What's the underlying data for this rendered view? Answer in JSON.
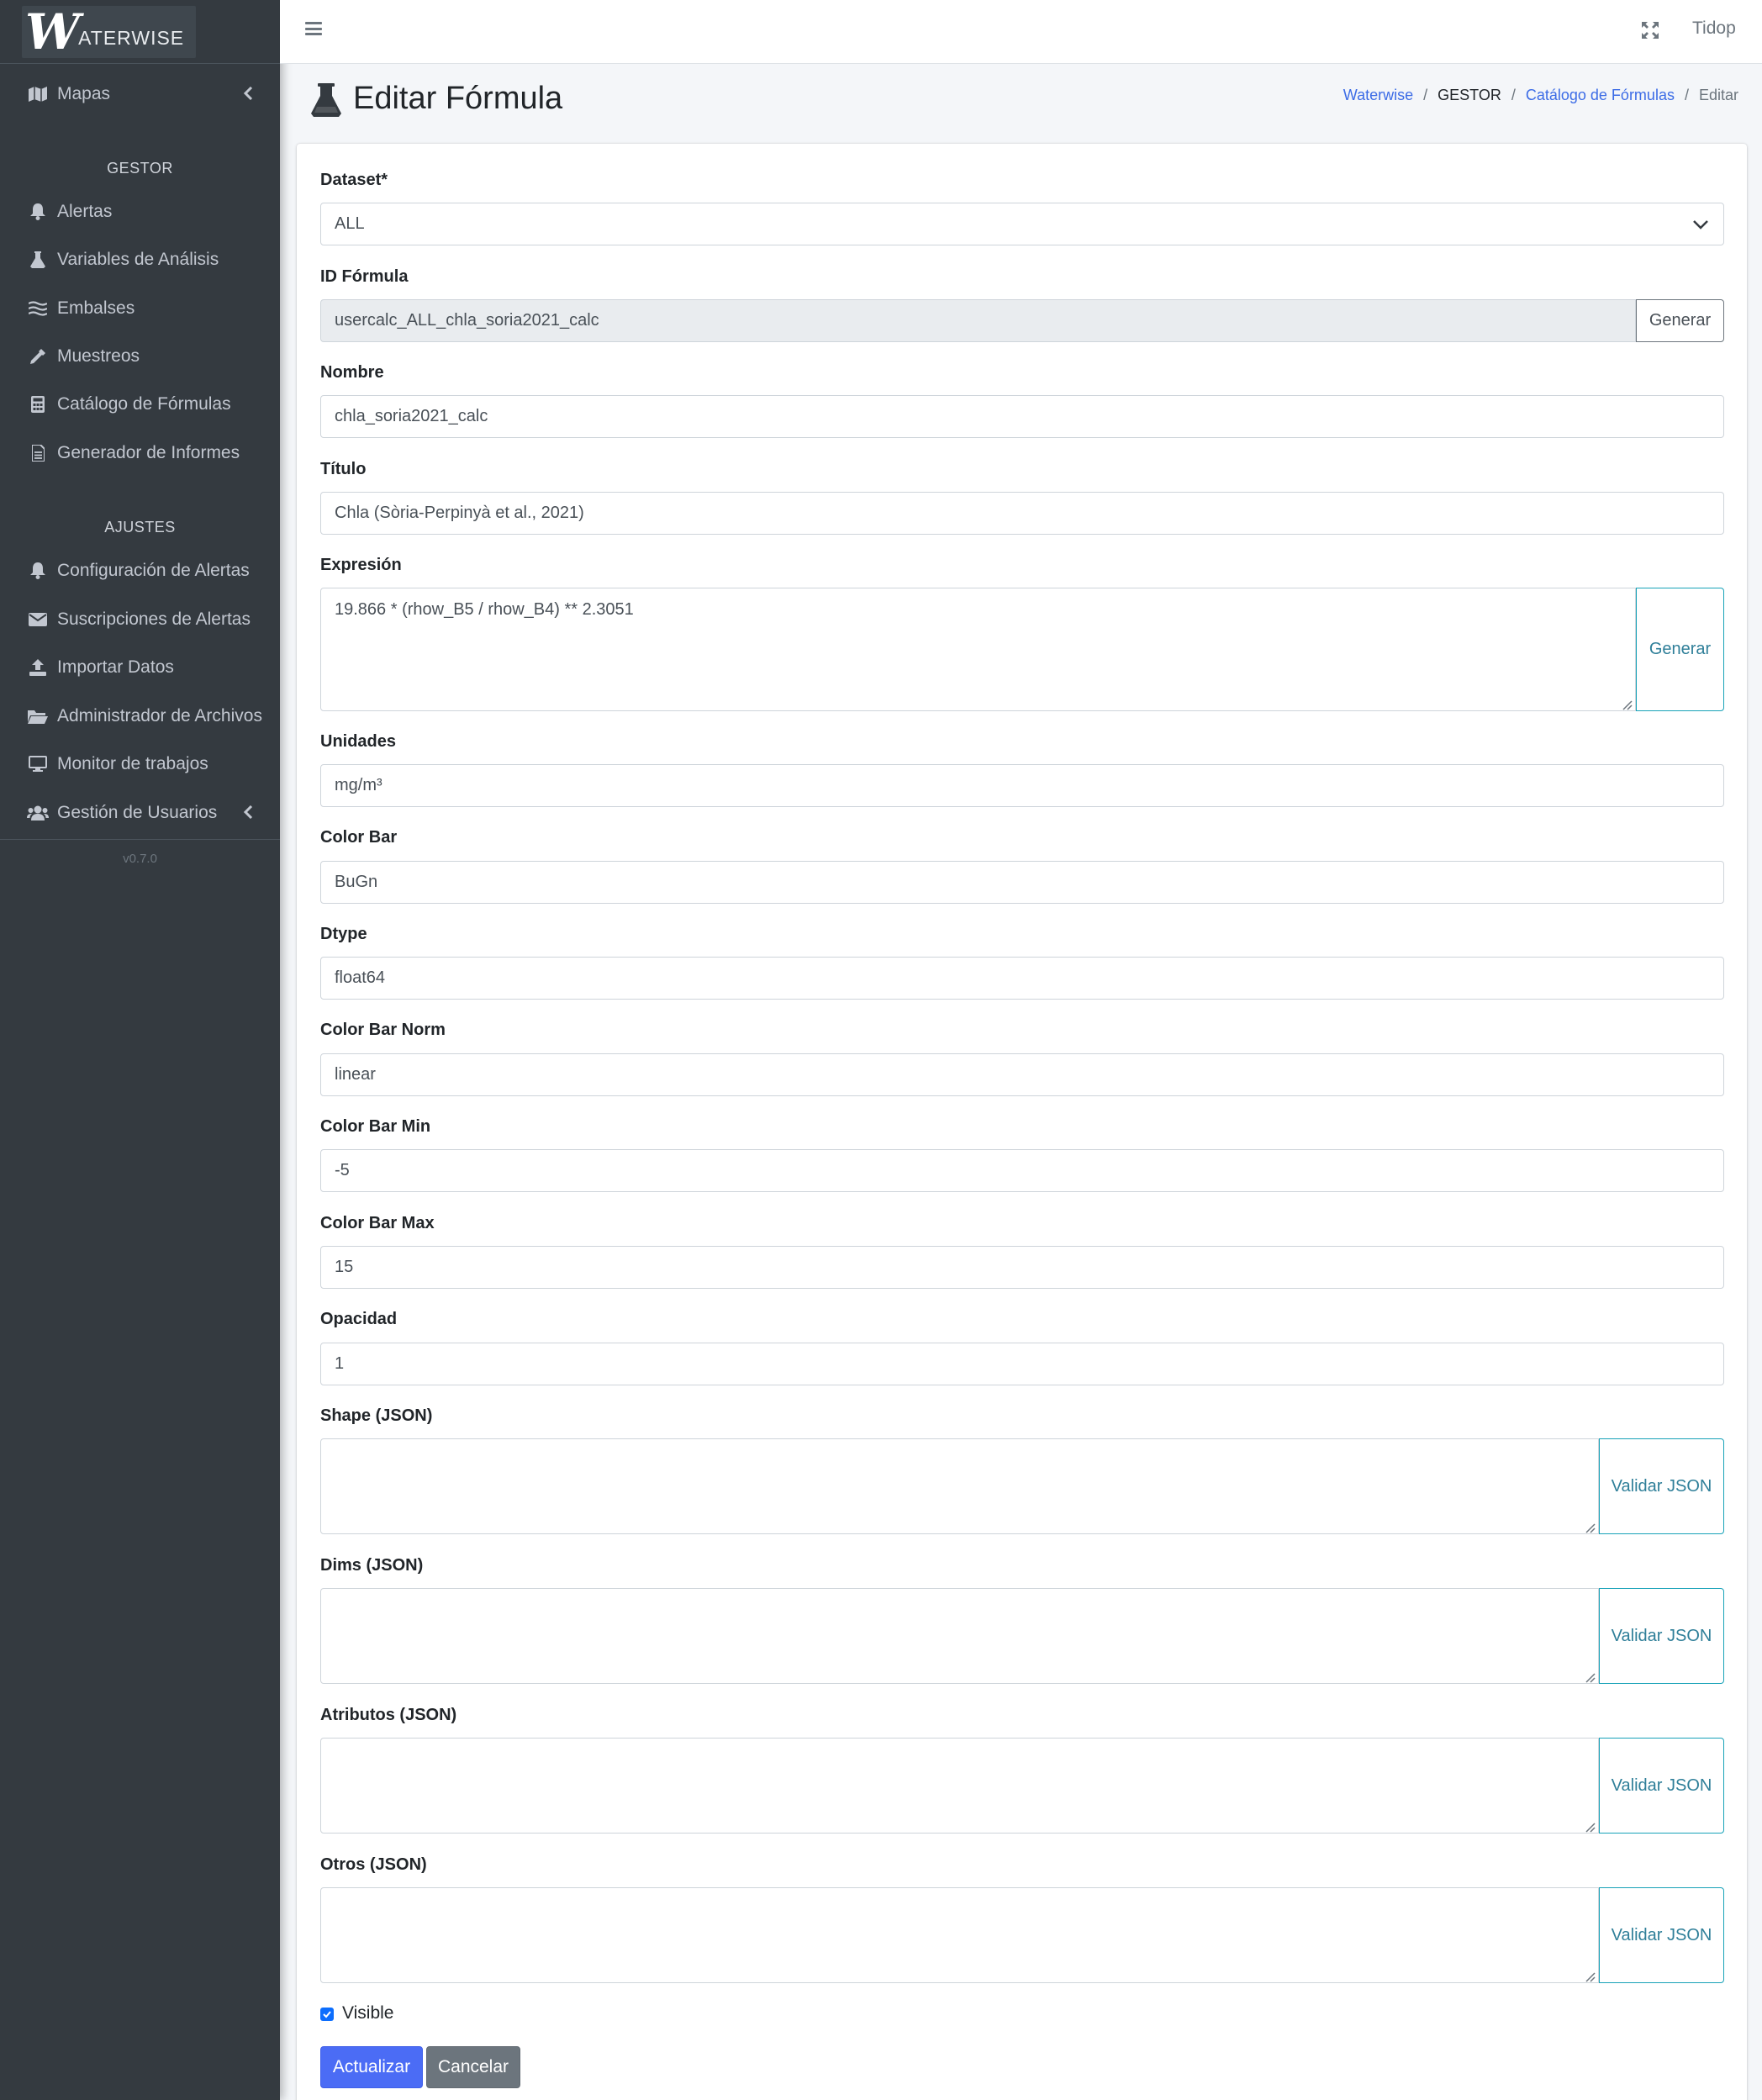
{
  "brand": {
    "letter": "W",
    "text": "ATERWISE"
  },
  "topbar": {
    "user": "Tidop"
  },
  "sidebar": {
    "items_top": [
      {
        "label": "Mapas",
        "icon": "map-icon"
      }
    ],
    "section_gestor": "GESTOR",
    "gestor_items": [
      {
        "label": "Alertas",
        "icon": "bell-icon"
      },
      {
        "label": "Variables de Análisis",
        "icon": "flask-icon"
      },
      {
        "label": "Embalses",
        "icon": "water-icon"
      },
      {
        "label": "Muestreos",
        "icon": "eyedropper-icon"
      },
      {
        "label": "Catálogo de Fórmulas",
        "icon": "calculator-icon"
      },
      {
        "label": "Generador de Informes",
        "icon": "file-alt-icon"
      }
    ],
    "section_ajustes": "AJUSTES",
    "ajustes_items": [
      {
        "label": "Configuración de Alertas",
        "icon": "bell-icon"
      },
      {
        "label": "Suscripciones de Alertas",
        "icon": "envelope-icon"
      },
      {
        "label": "Importar Datos",
        "icon": "upload-icon"
      },
      {
        "label": "Administrador de Archivos",
        "icon": "folder-open-icon"
      },
      {
        "label": "Monitor de trabajos",
        "icon": "desktop-icon"
      },
      {
        "label": "Gestión de Usuarios",
        "icon": "users-icon"
      }
    ],
    "version": "v0.7.0"
  },
  "page": {
    "title": "Editar Fórmula",
    "breadcrumb": [
      "Waterwise",
      "GESTOR",
      "Catálogo de Fórmulas",
      "Editar"
    ]
  },
  "form": {
    "dataset": {
      "label": "Dataset*",
      "value": "ALL"
    },
    "id_formula": {
      "label": "ID Fórmula",
      "value": "usercalc_ALL_chla_soria2021_calc",
      "button": "Generar"
    },
    "nombre": {
      "label": "Nombre",
      "value": "chla_soria2021_calc"
    },
    "titulo": {
      "label": "Título",
      "value": "Chla (Sòria-Perpinyà et al., 2021)"
    },
    "expresion": {
      "label": "Expresión",
      "value": "19.866 * (rhow_B5 / rhow_B4) ** 2.3051",
      "button": "Generar"
    },
    "unidades": {
      "label": "Unidades",
      "value": "mg/m³"
    },
    "color_bar": {
      "label": "Color Bar",
      "value": "BuGn"
    },
    "dtype": {
      "label": "Dtype",
      "value": "float64"
    },
    "color_bar_norm": {
      "label": "Color Bar Norm",
      "value": "linear"
    },
    "color_bar_min": {
      "label": "Color Bar Min",
      "value": "-5"
    },
    "color_bar_max": {
      "label": "Color Bar Max",
      "value": "15"
    },
    "opacidad": {
      "label": "Opacidad",
      "value": "1"
    },
    "shape": {
      "label": "Shape (JSON)",
      "value": "",
      "button": "Validar JSON"
    },
    "dims": {
      "label": "Dims (JSON)",
      "value": "",
      "button": "Validar JSON"
    },
    "atributos": {
      "label": "Atributos (JSON)",
      "value": "",
      "button": "Validar JSON"
    },
    "otros": {
      "label": "Otros (JSON)",
      "value": "",
      "button": "Validar JSON"
    },
    "visible": {
      "label": "Visible",
      "checked": true
    },
    "submit": "Actualizar",
    "cancel": "Cancelar"
  }
}
